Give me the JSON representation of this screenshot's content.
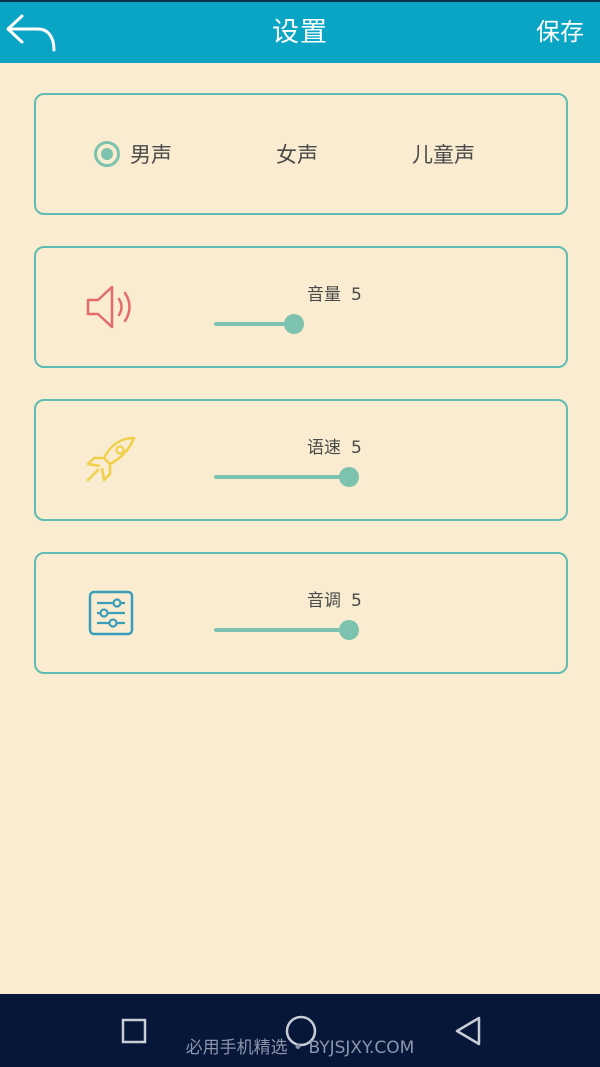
{
  "header": {
    "title": "设置",
    "save_label": "保存",
    "back_icon": "back-arrow-icon"
  },
  "voice": {
    "options": [
      {
        "label": "男声",
        "selected": true
      },
      {
        "label": "女声",
        "selected": false
      },
      {
        "label": "儿童声",
        "selected": false
      }
    ]
  },
  "sliders": [
    {
      "label": "音量",
      "value": "5",
      "fill": 0.55,
      "icon": "speaker-icon",
      "icon_color": "#e46b6b"
    },
    {
      "label": "语速",
      "value": "5",
      "fill": 0.93,
      "icon": "rocket-icon",
      "icon_color": "#f0d04a"
    },
    {
      "label": "音调",
      "value": "5",
      "fill": 0.93,
      "icon": "equalizer-icon",
      "icon_color": "#3a9dbb"
    }
  ],
  "navbar": {
    "watermark": "必用手机精选 • BYJSJXY.COM"
  },
  "colors": {
    "header": "#0aa5c4",
    "background": "#faecd0",
    "accent": "#7cc2ae",
    "border": "#5fbcb3"
  }
}
